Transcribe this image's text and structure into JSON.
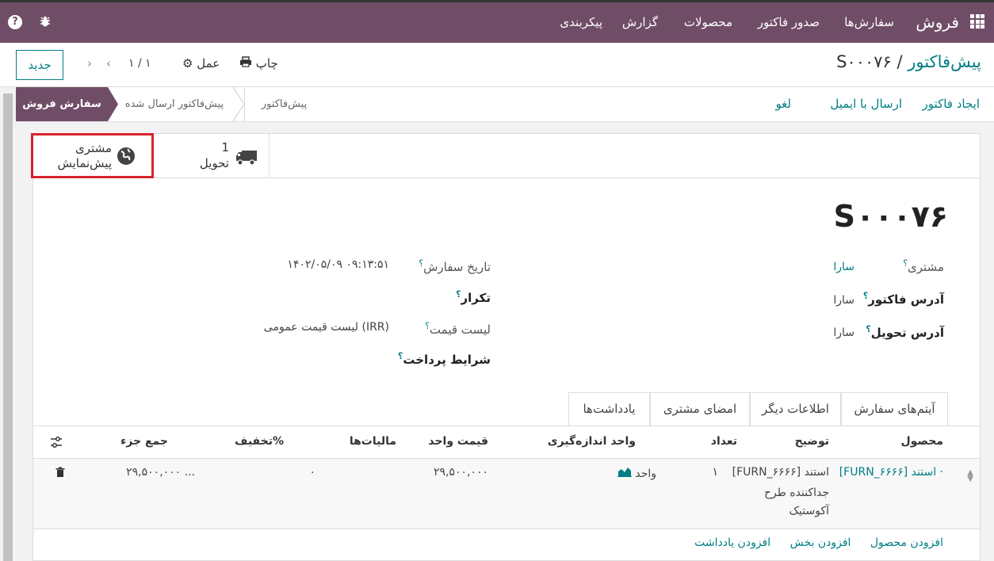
{
  "nav": {
    "brand": "فروش",
    "menu": [
      "سفارش‌ها",
      "صدور فاکتور",
      "محصولات",
      "گزارش",
      "پیکربندی"
    ],
    "help_glyph": "?",
    "icons": [
      "apps-icon",
      "help-icon",
      "bug-icon"
    ]
  },
  "control_panel": {
    "breadcrumb_parent": "پیش‌فاکتور",
    "breadcrumb_sep": "/",
    "breadcrumb_current": "S۰۰۰۷۶",
    "new_button": "جدید",
    "pager": "۱ / ۱",
    "print": "چاپ",
    "action": "عمل"
  },
  "status_bar": {
    "buttons": [
      "ایجاد فاکتور",
      "ارسال با ایمیل",
      "لغو"
    ],
    "stages": [
      "سفارش فروش",
      "پیش‌فاکتور ارسال شده",
      "پیش‌فاکتور"
    ],
    "active_stage": "سفارش فروش"
  },
  "smart_buttons": {
    "delivery_count": "1",
    "delivery_label": "تحویل",
    "preview_line1": "مشتری",
    "preview_line2": "پیش‌نمایش"
  },
  "record": {
    "name": "S۰۰۰۷۶",
    "customer_label": "مشتری",
    "customer_value": "سارا",
    "invoice_address_label": "آدرس فاکتور",
    "invoice_address_value": "سارا",
    "delivery_address_label": "آدرس تحویل",
    "delivery_address_value": "سارا",
    "order_date_label": "تاریخ سفارش",
    "order_date_value": "۱۴۰۲/۰۵/۰۹ ۰۹:۱۳:۵۱",
    "recurrence_label": "تکرار",
    "pricelist_label": "لیست قیمت",
    "pricelist_value": "لیست قیمت عمومی (IRR)",
    "payment_terms_label": "شرایط پرداخت",
    "help_mark": "؟"
  },
  "tabs": [
    "آیتم‌های سفارش",
    "اطلاعات دیگر",
    "امضای مشتری",
    "یادداشت‌ها"
  ],
  "table": {
    "headers": [
      "محصول",
      "توضیح",
      "تعداد",
      "واحد اندازه‌گیری",
      "قیمت واحد",
      "مالیات‌ها",
      "تخفیف%",
      "جمع جزء"
    ],
    "row": {
      "product": "[FURN_۶۶۶۶] استند ·",
      "description_line1": "[FURN_۶۶۶۶] استند",
      "description_line2": "جداکننده طرح",
      "description_line3": "آکوستیک",
      "quantity": "۱",
      "uom": "واحد",
      "unit_price": "۲۹,۵۰۰,۰۰۰",
      "discount": "۰",
      "subtotal": "۲۹,۵۰۰,۰۰۰ ..."
    },
    "add_links": [
      "افزودن محصول",
      "افزودن بخش",
      "افزودن یادداشت"
    ]
  }
}
